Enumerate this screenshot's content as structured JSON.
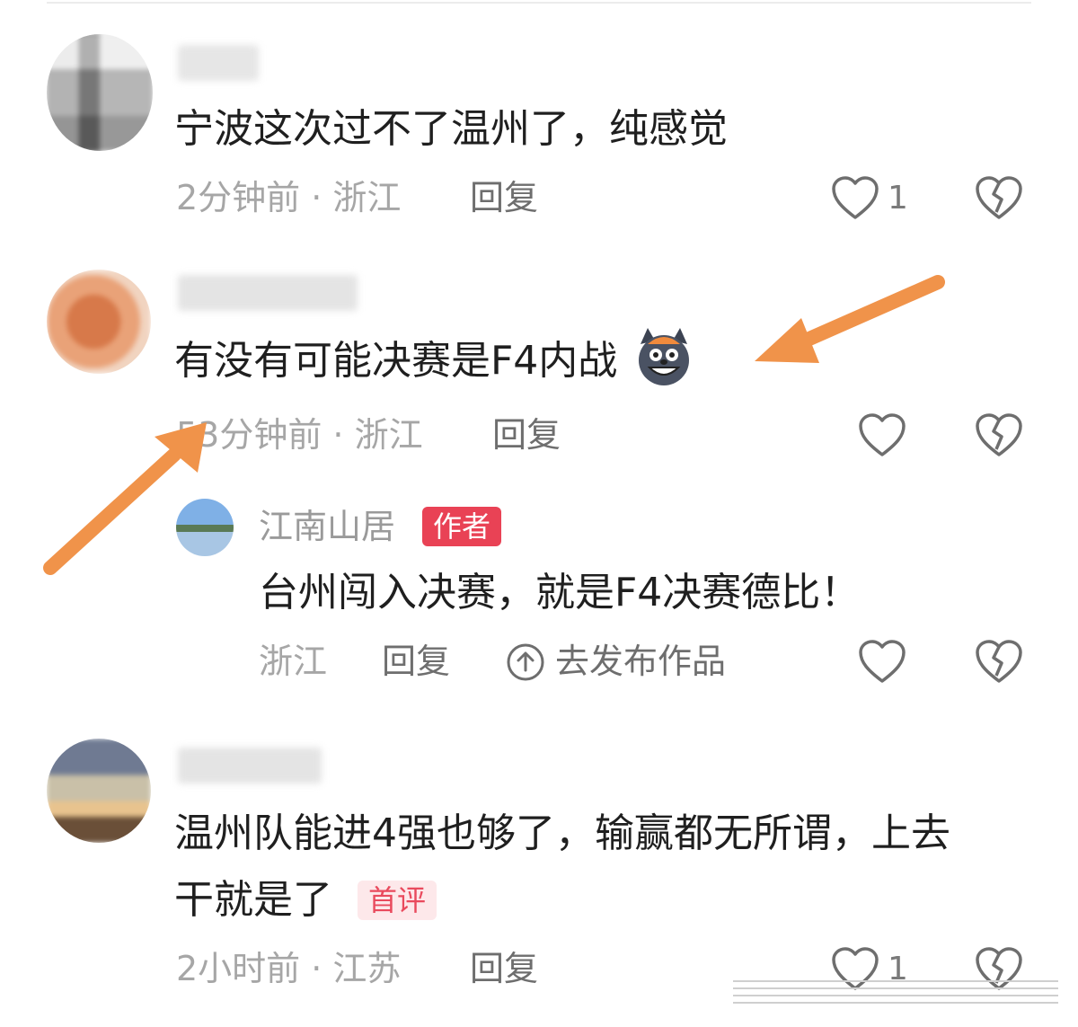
{
  "comments": [
    {
      "text": "宁波这次过不了温州了，纯感觉",
      "meta": "2分钟前 · 浙江",
      "reply": "回复",
      "likes": "1"
    },
    {
      "text": "有没有可能决赛是F4内战",
      "meta": "53分钟前 · 浙江",
      "reply": "回复",
      "emoji_icon": "grinning-wolf-emoji-icon",
      "reply_thread": {
        "name": "江南山居",
        "badge": "作者",
        "text": "台州闯入决赛，就是F4决赛德比！",
        "meta": "浙江",
        "reply": "回复",
        "publish": "去发布作品"
      }
    },
    {
      "text_line1": "温州队能进4强也够了，输赢都无所谓，上去",
      "text_line2": "干就是了",
      "badge": "首评",
      "meta": "2小时前 · 江苏",
      "reply": "回复",
      "likes": "1"
    }
  ],
  "annotations": {
    "arrow_color": "#f0934a"
  },
  "colors": {
    "author_badge": "#e94255",
    "first_badge_bg": "#fde8ea",
    "first_badge_text": "#e94a5d"
  }
}
